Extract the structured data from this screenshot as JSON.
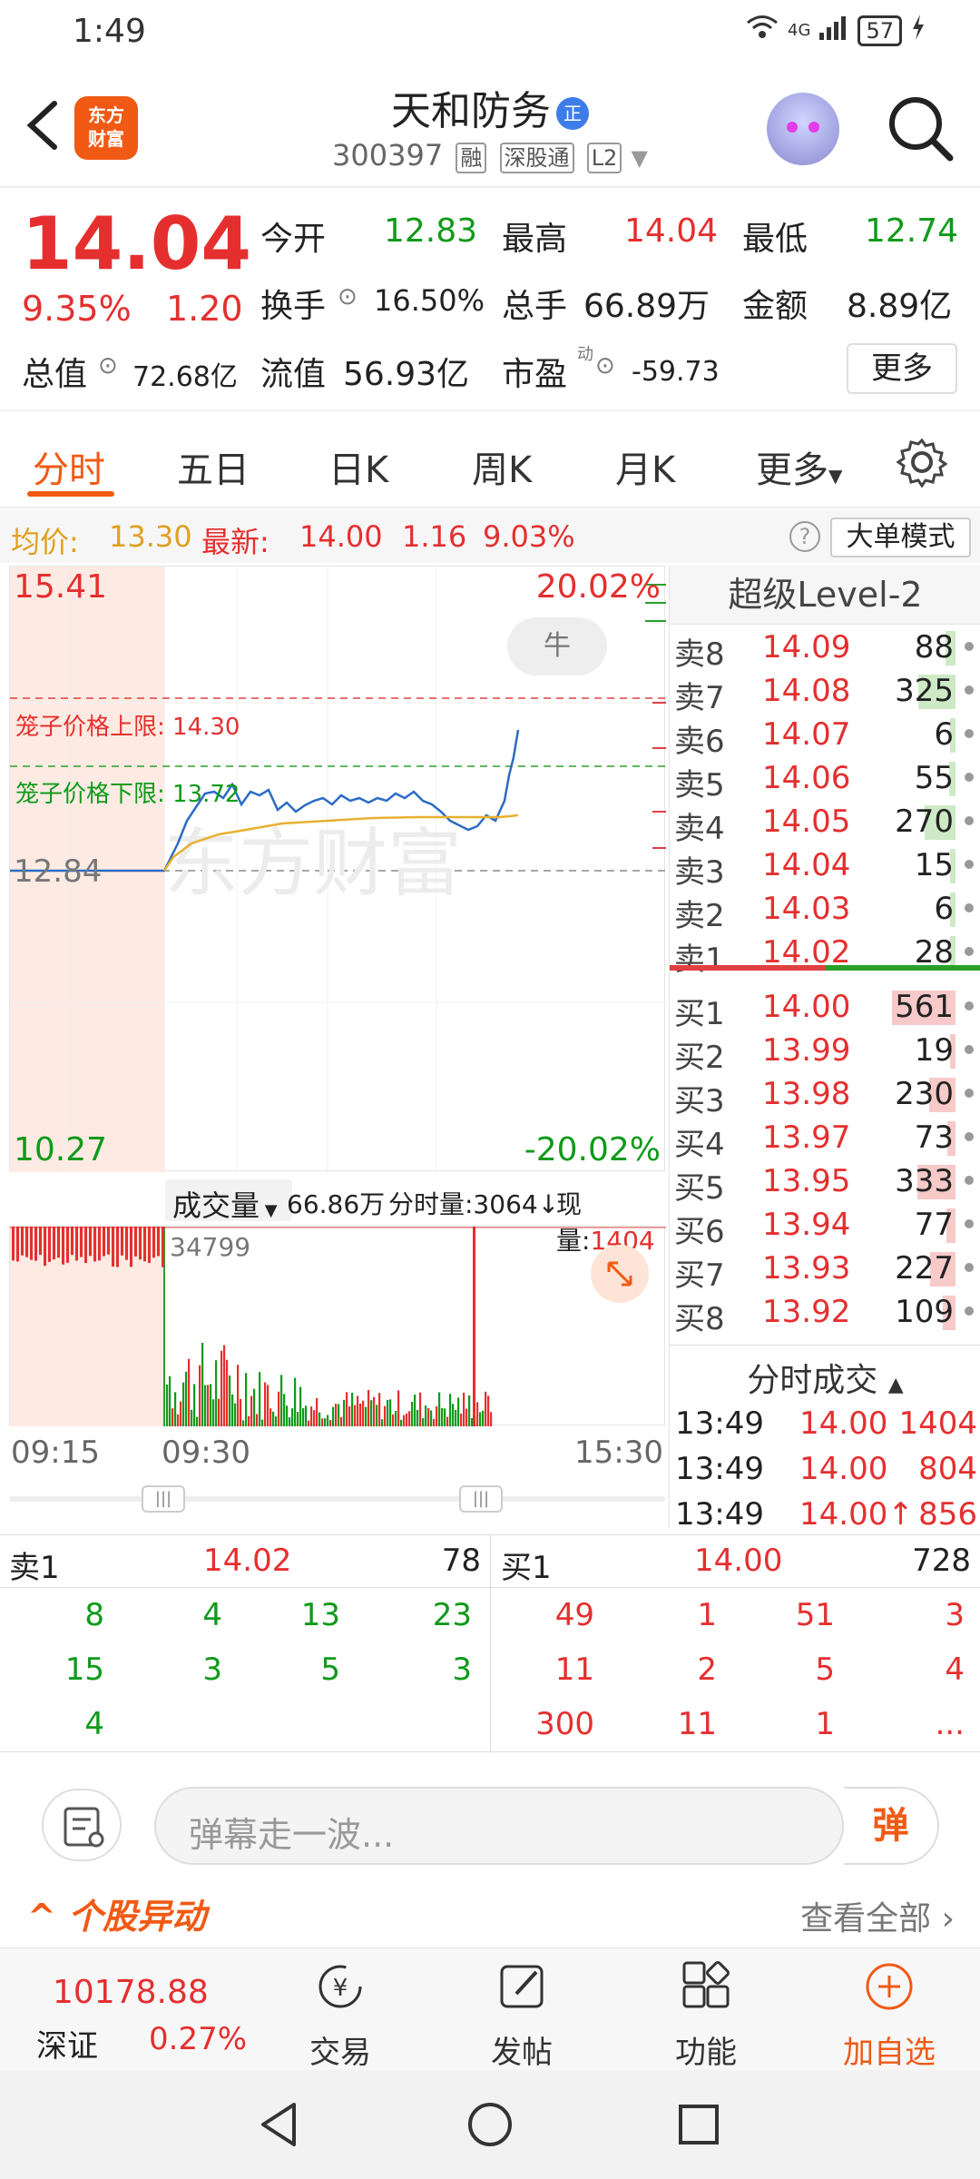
{
  "status_bar": {
    "time": "1:49",
    "network": "4G",
    "battery": "57"
  },
  "header": {
    "app_logo": "东方\n财富",
    "stock_name": "天和防务",
    "name_badge": "正",
    "stock_code": "300397",
    "tags": [
      "融",
      "深股通",
      "L2"
    ]
  },
  "quote": {
    "price": "14.04",
    "change_pct": "9.35%",
    "change_amt": "1.20",
    "open_label": "今开",
    "open": "12.83",
    "high_label": "最高",
    "high": "14.04",
    "low_label": "最低",
    "low": "12.74",
    "turnover_label": "换手",
    "turnover": "16.50%",
    "volume_label": "总手",
    "volume": "66.89万",
    "amount_label": "金额",
    "amount": "8.89亿",
    "mktcap_label": "总值",
    "mktcap": "72.68亿",
    "float_label": "流值",
    "float_val": "56.93亿",
    "pe_label": "市盈",
    "pe_sup": "动",
    "pe": "-59.73",
    "more_label": "更多"
  },
  "tabs": [
    "分时",
    "五日",
    "日K",
    "周K",
    "月K",
    "更多"
  ],
  "infoline": {
    "avg_label": "均价:",
    "avg": "13.30",
    "latest_label": "最新:",
    "latest": "14.00",
    "latest_chg": "1.16",
    "latest_pct": "9.03%",
    "big_order": "大单模式"
  },
  "chart": {
    "top_price": "15.41",
    "top_pct": "20.02%",
    "bottom_price": "10.27",
    "bottom_pct": "-20.02%",
    "mid_price": "12.84",
    "cage_upper_label": "笼子价格上限:",
    "cage_upper": "14.30",
    "cage_lower_label": "笼子价格下限:",
    "cage_lower": "13.72",
    "bull_label": "牛",
    "watermark": "东方财富",
    "colors": {
      "price_line": "#2b6cc4",
      "avg_line": "#e8b030",
      "up": "#e52f2f",
      "down": "#109a1a"
    }
  },
  "volume": {
    "selector": "成交量",
    "total": "66.86万",
    "minute_vol": "分时量:3064↓",
    "current": "现量:",
    "current_val": "1404",
    "max_label": "34799"
  },
  "time_axis": [
    "09:15",
    "09:30",
    "15:30"
  ],
  "book": {
    "title": "超级Level-2",
    "sells": [
      {
        "label": "卖8",
        "price": "14.09",
        "vol": "88"
      },
      {
        "label": "卖7",
        "price": "14.08",
        "vol": "325"
      },
      {
        "label": "卖6",
        "price": "14.07",
        "vol": "6"
      },
      {
        "label": "卖5",
        "price": "14.06",
        "vol": "55"
      },
      {
        "label": "卖4",
        "price": "14.05",
        "vol": "270"
      },
      {
        "label": "卖3",
        "price": "14.04",
        "vol": "15"
      },
      {
        "label": "卖2",
        "price": "14.03",
        "vol": "6"
      },
      {
        "label": "卖1",
        "price": "14.02",
        "vol": "28"
      }
    ],
    "buys": [
      {
        "label": "买1",
        "price": "14.00",
        "vol": "561"
      },
      {
        "label": "买2",
        "price": "13.99",
        "vol": "19"
      },
      {
        "label": "买3",
        "price": "13.98",
        "vol": "230"
      },
      {
        "label": "买4",
        "price": "13.97",
        "vol": "73"
      },
      {
        "label": "买5",
        "price": "13.95",
        "vol": "333"
      },
      {
        "label": "买6",
        "price": "13.94",
        "vol": "77"
      },
      {
        "label": "买7",
        "price": "13.93",
        "vol": "227"
      },
      {
        "label": "买8",
        "price": "13.92",
        "vol": "109"
      }
    ],
    "trades_title": "分时成交",
    "trades": [
      {
        "time": "13:49",
        "price": "14.00",
        "vol": "1404"
      },
      {
        "time": "13:49",
        "price": "14.00",
        "vol": "804"
      },
      {
        "time": "13:49",
        "price": "14.00↑",
        "vol": "856"
      }
    ]
  },
  "queues": {
    "sell_label": "卖1",
    "sell_price": "14.02",
    "sell_total": "78",
    "buy_label": "买1",
    "buy_price": "14.00",
    "buy_total": "728",
    "sell_cells": [
      [
        "8",
        "4",
        "13",
        "23"
      ],
      [
        "15",
        "3",
        "5",
        "3"
      ],
      [
        "4",
        "",
        "",
        ""
      ]
    ],
    "buy_cells": [
      [
        "49",
        "1",
        "51",
        "3"
      ],
      [
        "11",
        "2",
        "5",
        "4"
      ],
      [
        "300",
        "11",
        "1",
        "..."
      ]
    ]
  },
  "danmu": {
    "placeholder": "弹幕走一波...",
    "send": "弹"
  },
  "anomaly": {
    "title": "个股异动",
    "view_all": "查看全部"
  },
  "bottom_nav": {
    "index_value": "10178.88",
    "index_name": "深证",
    "index_pct": "0.27%",
    "items": [
      "交易",
      "发帖",
      "功能",
      "加自选"
    ]
  }
}
